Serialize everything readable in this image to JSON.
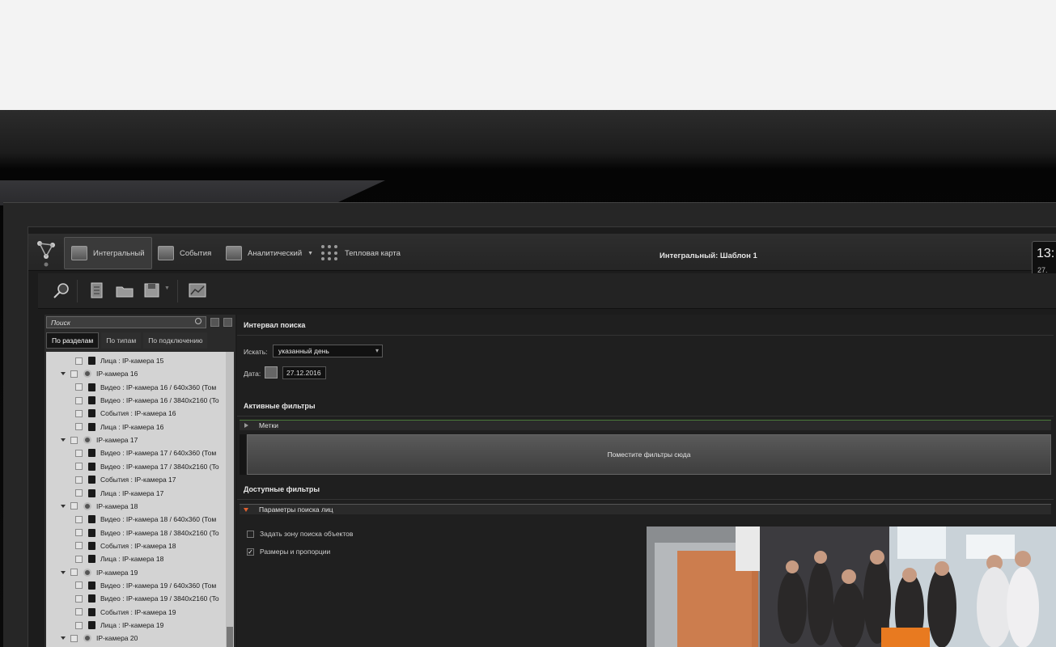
{
  "nav": {
    "integral_label": "Интегральный",
    "events_label": "События",
    "analytic_label": "Аналитический",
    "heatmap_label": "Тепловая карта",
    "center_title": "Интегральный: Шаблон 1",
    "clock_time": "13:",
    "clock_date": "27."
  },
  "toolbar": {
    "icons": [
      "search-icon",
      "new-document-icon",
      "open-folder-icon",
      "save-icon",
      "export-icon"
    ]
  },
  "left": {
    "search_placeholder": "Поиск",
    "tabs": [
      "По разделам",
      "По типам",
      "По подключению"
    ],
    "tree": [
      {
        "text": "Лица : IP-камера 15",
        "kind": "doc",
        "level": 2
      },
      {
        "text": "IP-камера 16",
        "kind": "cam",
        "level": 1
      },
      {
        "text": "Видео : IP-камера 16 / 640x360 (Том",
        "kind": "doc",
        "level": 2
      },
      {
        "text": "Видео : IP-камера 16 / 3840x2160 (To",
        "kind": "doc",
        "level": 2
      },
      {
        "text": "События : IP-камера 16",
        "kind": "doc",
        "level": 2
      },
      {
        "text": "Лица : IP-камера 16",
        "kind": "doc",
        "level": 2
      },
      {
        "text": "IP-камера 17",
        "kind": "cam",
        "level": 1
      },
      {
        "text": "Видео : IP-камера 17 / 640x360 (Том",
        "kind": "doc",
        "level": 2
      },
      {
        "text": "Видео : IP-камера 17 / 3840x2160 (To",
        "kind": "doc",
        "level": 2
      },
      {
        "text": "События : IP-камера 17",
        "kind": "doc",
        "level": 2
      },
      {
        "text": "Лица : IP-камера 17",
        "kind": "doc",
        "level": 2
      },
      {
        "text": "IP-камера 18",
        "kind": "cam",
        "level": 1
      },
      {
        "text": "Видео : IP-камера 18 / 640x360 (Том",
        "kind": "doc",
        "level": 2
      },
      {
        "text": "Видео : IP-камера 18 / 3840x2160 (To",
        "kind": "doc",
        "level": 2
      },
      {
        "text": "События : IP-камера 18",
        "kind": "doc",
        "level": 2
      },
      {
        "text": "Лица : IP-камера 18",
        "kind": "doc",
        "level": 2
      },
      {
        "text": "IP-камера 19",
        "kind": "cam",
        "level": 1
      },
      {
        "text": "Видео : IP-камера 19 / 640x360 (Том",
        "kind": "doc",
        "level": 2
      },
      {
        "text": "Видео : IP-камера 19 / 3840x2160 (To",
        "kind": "doc",
        "level": 2
      },
      {
        "text": "События : IP-камера 19",
        "kind": "doc",
        "level": 2
      },
      {
        "text": "Лица : IP-камера 19",
        "kind": "doc",
        "level": 2
      },
      {
        "text": "IP-камера 20",
        "kind": "cam",
        "level": 1
      }
    ]
  },
  "main": {
    "interval_header": "Интервал поиска",
    "search_label": "Искать:",
    "search_value": "указанный день",
    "date_label": "Дата:",
    "date_value": "27.12.2016",
    "active_filters_header": "Активные фильтры",
    "tags_label": "Метки",
    "dropzone_text": "Поместите фильтры сюда",
    "available_filters_header": "Доступные фильтры",
    "face_params_label": "Параметры поиска лиц",
    "zone_option": "Задать зону поиска объектов",
    "size_option": "Размеры и пропорции",
    "size_option_checked": true,
    "zone_option_checked": false
  },
  "colors": {
    "accent_green": "#4a7a3a",
    "accent_orange": "#e06030"
  }
}
